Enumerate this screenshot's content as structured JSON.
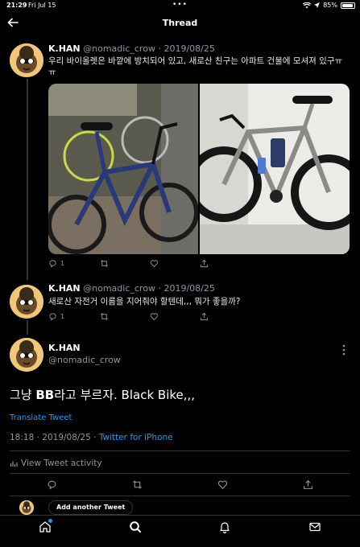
{
  "status_bar": {
    "time": "21:29",
    "date": "Fri Jul 15",
    "battery": "85%"
  },
  "header": {
    "title": "Thread"
  },
  "tweet1": {
    "name": "K.HAN",
    "handle": "@nomadic_crow",
    "date": "· 2019/08/25",
    "text_line1": "우리 바이올렛은 바깥에 방치되어 있고, 새로산 친구는 아파트 건물에 모셔져 있구ㅠ",
    "text_line2": "ㅠ",
    "reply_count": "1"
  },
  "tweet2": {
    "name": "K.HAN",
    "handle": "@nomadic_crow",
    "date": "· 2019/08/25",
    "text": "새로산 자전거 이름을 지어줘야 할텐데,,, 뭐가 좋을까?",
    "reply_count": "1"
  },
  "main_tweet": {
    "name": "K.HAN",
    "handle": "@nomadic_crow",
    "text_pre": "그냥 ",
    "text_bold": "BB",
    "text_post": "라고 부르자. Black Bike,,,",
    "translate": "Translate Tweet",
    "timestamp": "18:18 · 2019/08/25 · ",
    "source": "Twitter for iPhone",
    "activity": "View Tweet activity"
  },
  "reply_bar": {
    "button": "Add another Tweet"
  },
  "colors": {
    "accent": "#1d9bf0",
    "muted": "#8b98a5",
    "bg": "#000000"
  }
}
